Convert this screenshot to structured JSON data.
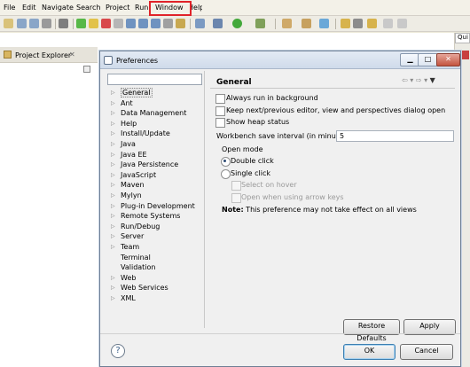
{
  "menubar": {
    "items": [
      "File",
      "Edit",
      "Navigate",
      "Search",
      "Project",
      "Run",
      "Window",
      "Help"
    ]
  },
  "workbench": {
    "project_explorer_label": "Project Explorer",
    "quick_access": "Qui"
  },
  "dialog": {
    "title": "Preferences",
    "filter_value": "",
    "tree_items": [
      {
        "label": "General",
        "arrow": true,
        "selected": true
      },
      {
        "label": "Ant",
        "arrow": true
      },
      {
        "label": "Data Management",
        "arrow": true
      },
      {
        "label": "Help",
        "arrow": true
      },
      {
        "label": "Install/Update",
        "arrow": true
      },
      {
        "label": "Java",
        "arrow": true
      },
      {
        "label": "Java EE",
        "arrow": true
      },
      {
        "label": "Java Persistence",
        "arrow": true
      },
      {
        "label": "JavaScript",
        "arrow": true
      },
      {
        "label": "Maven",
        "arrow": true
      },
      {
        "label": "Mylyn",
        "arrow": true
      },
      {
        "label": "Plug-in Development",
        "arrow": true
      },
      {
        "label": "Remote Systems",
        "arrow": true
      },
      {
        "label": "Run/Debug",
        "arrow": true
      },
      {
        "label": "Server",
        "arrow": true
      },
      {
        "label": "Team",
        "arrow": true
      },
      {
        "label": "Terminal",
        "arrow": false
      },
      {
        "label": "Validation",
        "arrow": false
      },
      {
        "label": "Web",
        "arrow": true
      },
      {
        "label": "Web Services",
        "arrow": true
      },
      {
        "label": "XML",
        "arrow": true
      }
    ],
    "page": {
      "title": "General",
      "always_run_bg": "Always run in background",
      "keep_prev_next": "Keep next/previous editor, view and perspectives dialog open",
      "show_heap": "Show heap status",
      "interval_label": "Workbench save interval (in minutes):",
      "interval_value": "5",
      "open_mode_label": "Open mode",
      "double_click": "Double click",
      "single_click": "Single click",
      "select_on_hover": "Select on hover",
      "open_arrow_keys": "Open when using arrow keys",
      "note_prefix": "Note:",
      "note_text": " This preference may not take effect on all views"
    },
    "buttons": {
      "restore_defaults": "Restore Defaults",
      "apply": "Apply",
      "ok": "OK",
      "cancel": "Cancel"
    }
  }
}
